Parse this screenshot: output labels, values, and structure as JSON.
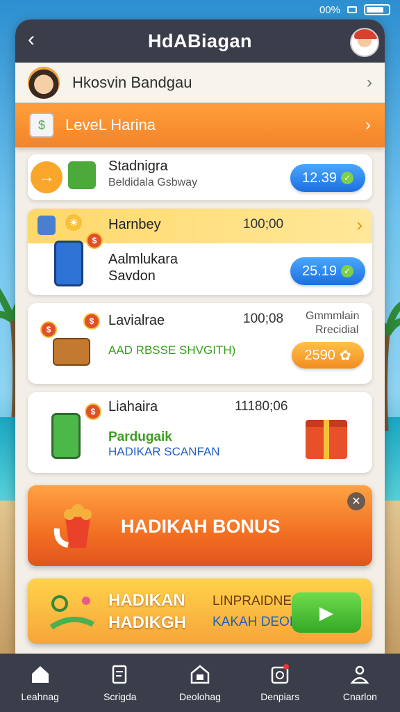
{
  "status_bar": {
    "text": "00%"
  },
  "header": {
    "title": "HdABiagan"
  },
  "user": {
    "name": "Hkosvin Bandgau"
  },
  "level": {
    "label": "LeveL Harina"
  },
  "cards": [
    {
      "title": "Stadnigra",
      "subtitle": "Beldidala Gsbway",
      "pill": "12.39"
    },
    {
      "header": "Harnbey",
      "time": "100;00",
      "title": "Aalmlukara",
      "subtitle": "Savdon",
      "pill": "25.19"
    },
    {
      "title": "Lavialrae",
      "time": "100;08",
      "note1": "Gmmmlain",
      "note2": "Rrecidial",
      "green": "AAD RBSSE SHVGITH)",
      "pill": "2590"
    },
    {
      "title": "Liahaira",
      "time": "11180;06",
      "green": "Pardugaik",
      "blue": "HADIKAR SCANFAN"
    }
  ],
  "bonus": {
    "label": "HADIKAH BONUS"
  },
  "promo": {
    "line1": "HADIKAN",
    "line2": "HADIKGH",
    "right1": "LINPRAIDNEAI",
    "right2": "KAKAH DEODNUN"
  },
  "tabs": [
    {
      "label": "Leahnag",
      "icon": "home-icon"
    },
    {
      "label": "Scrigda",
      "icon": "ticket-icon"
    },
    {
      "label": "Deolohag",
      "icon": "wallet-icon"
    },
    {
      "label": "Denpiars",
      "icon": "notification-icon"
    },
    {
      "label": "Cnarlon",
      "icon": "profile-icon"
    }
  ]
}
